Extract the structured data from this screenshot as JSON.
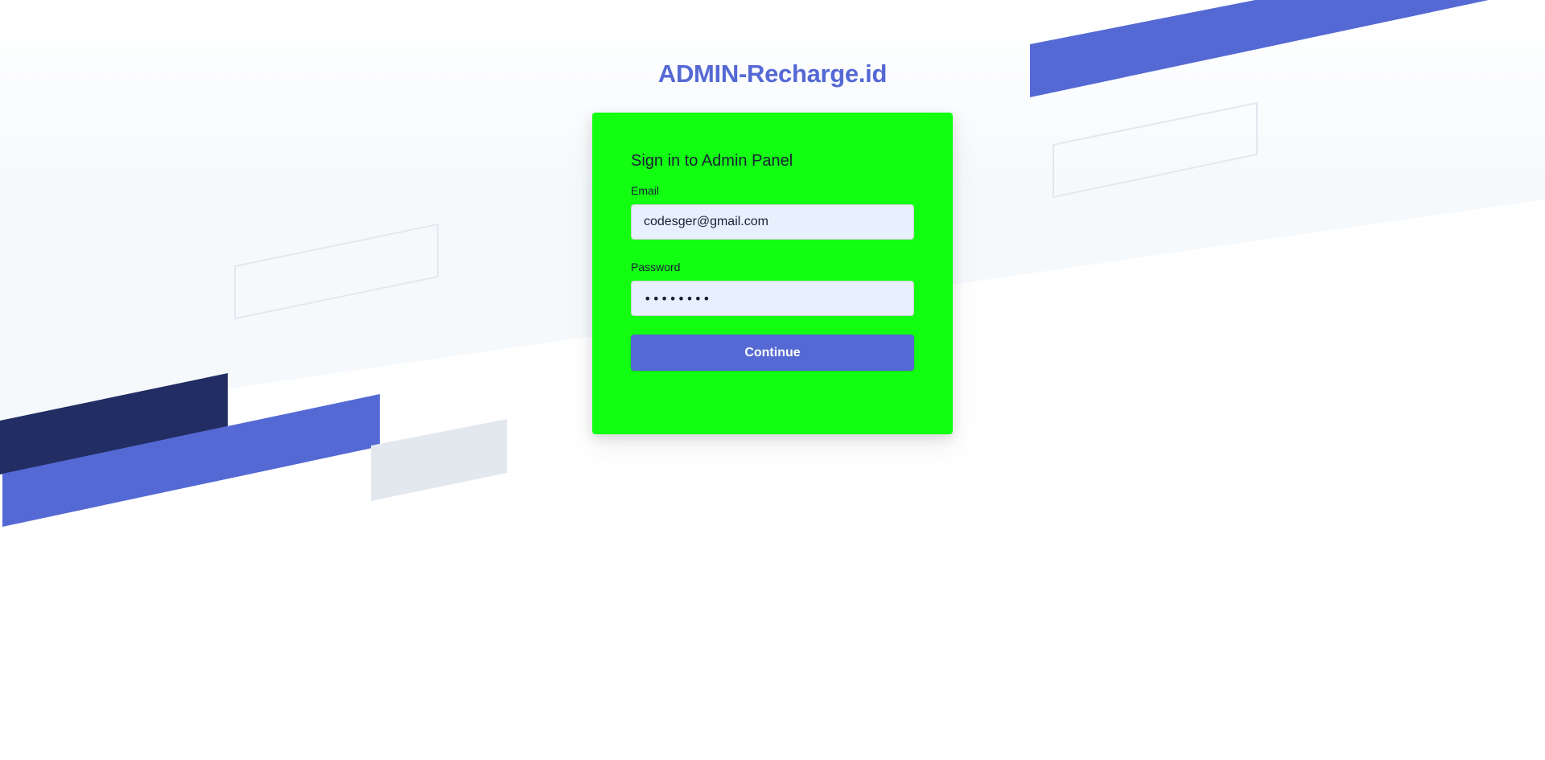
{
  "brand": {
    "title": "ADMIN-Recharge.id",
    "color": "#5469d4"
  },
  "login_form": {
    "heading": "Sign in to Admin Panel",
    "email_label": "Email",
    "email_value": "codesger@gmail.com",
    "password_label": "Password",
    "password_value": "••••••••",
    "submit_label": "Continue",
    "card_color": "#12ff12",
    "button_color": "#5469d4",
    "input_fill": "#e8f0fe"
  },
  "background": {
    "colors": {
      "accent_blue": "#5469d4",
      "navy": "#212d63",
      "light_gray": "#e3e8ee",
      "outline_gray": "#e3e8ee",
      "tint": "#f6f9fc"
    }
  }
}
